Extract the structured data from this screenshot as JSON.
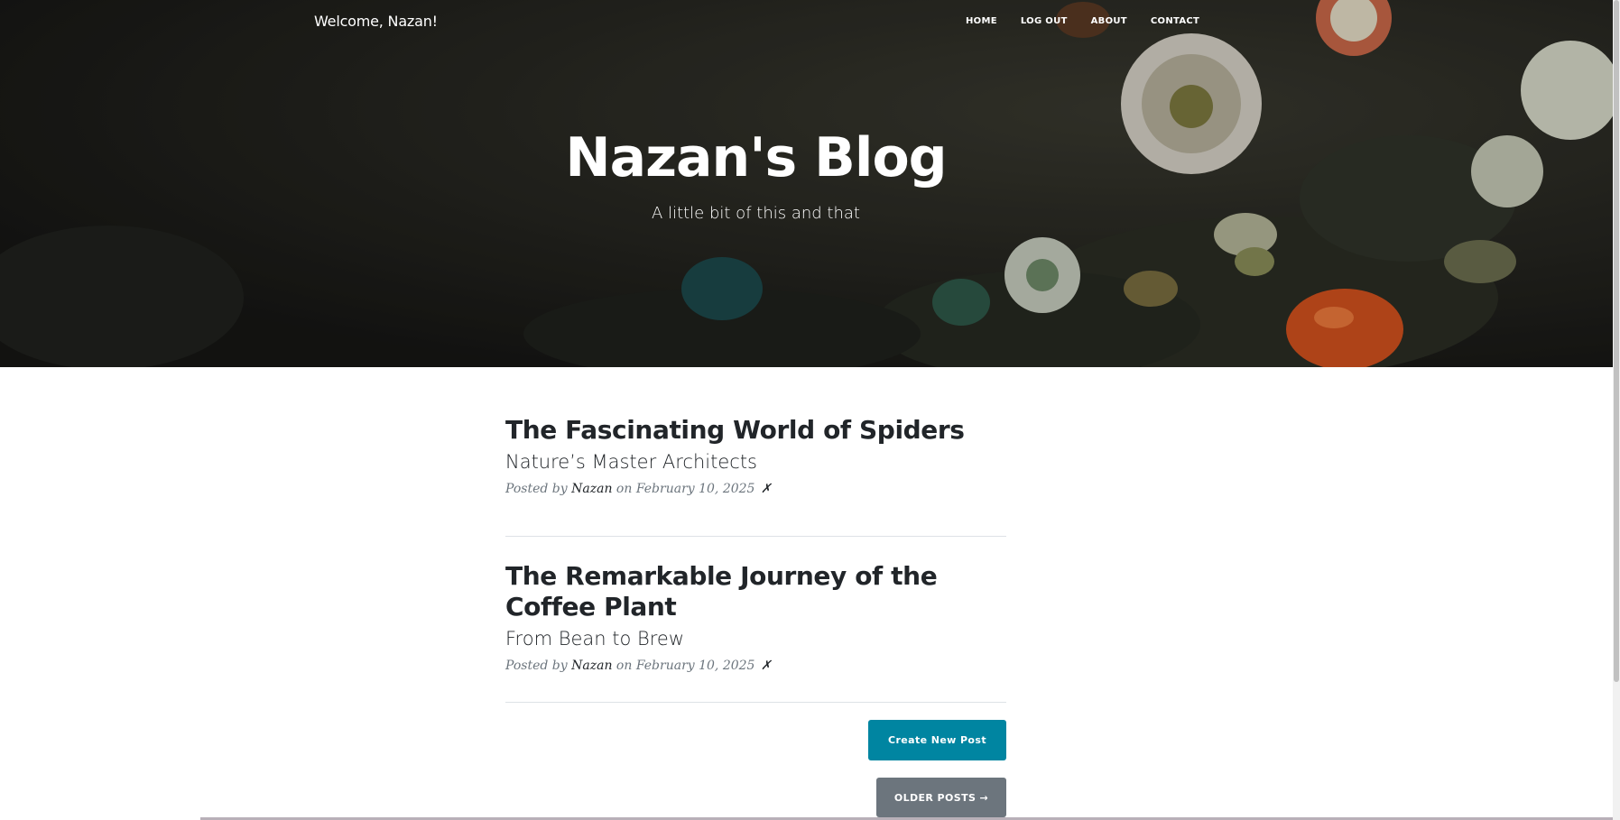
{
  "navbar": {
    "brand": "Welcome, Nazan!",
    "links": [
      "Home",
      "Log Out",
      "About",
      "Contact"
    ]
  },
  "hero": {
    "title": "Nazan's Blog",
    "subtitle": "A little bit of this and that"
  },
  "posts": [
    {
      "title": "The Fascinating World of Spiders",
      "subtitle": "Nature’s Master Architects",
      "meta_prefix": "Posted by",
      "author": "Nazan",
      "meta_date": "on February 10, 2025",
      "delete_glyph": "✗"
    },
    {
      "title": "The Remarkable Journey of the Coffee Plant",
      "subtitle": "From Bean to Brew",
      "meta_prefix": "Posted by",
      "author": "Nazan",
      "meta_date": "on February 10, 2025",
      "delete_glyph": "✗"
    }
  ],
  "buttons": {
    "create": "Create New Post",
    "older": "Older Posts →"
  },
  "colors": {
    "primary": "#0085a1",
    "secondary": "#6c757d",
    "text": "#212529",
    "meta": "#6c757d"
  }
}
